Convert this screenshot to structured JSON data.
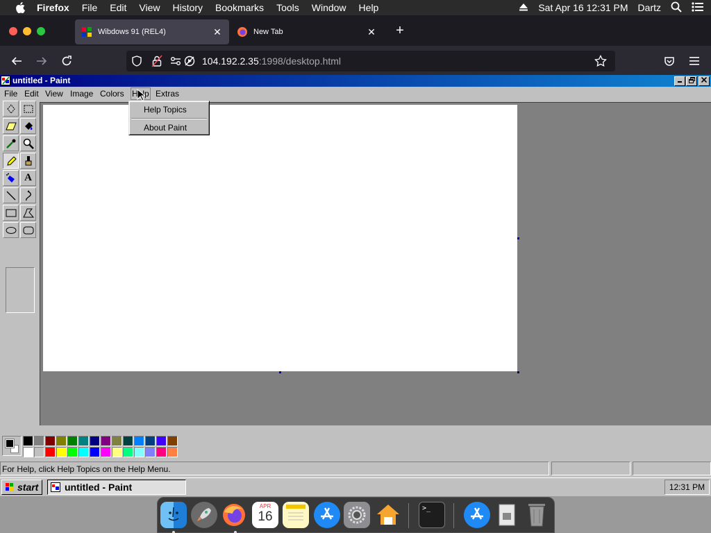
{
  "mac_menubar": {
    "app_name": "Firefox",
    "items": [
      "File",
      "Edit",
      "View",
      "History",
      "Bookmarks",
      "Tools",
      "Window",
      "Help"
    ],
    "datetime": "Sat Apr 16  12:31 PM",
    "user": "Dartz"
  },
  "browser": {
    "tabs": [
      {
        "title": "Wibdows 91 (REL4)",
        "active": true
      },
      {
        "title": "New Tab",
        "active": false
      }
    ],
    "url_host": "104.192.2.35",
    "url_path": ":1998/desktop.html"
  },
  "paint": {
    "title": "untitled - Paint",
    "menus": [
      "File",
      "Edit",
      "View",
      "Image",
      "Colors",
      "Help",
      "Extras"
    ],
    "help_menu_items": [
      "Help Topics",
      "About Paint"
    ],
    "status_text": "For Help, click Help Topics on the Help Menu.",
    "palette_top": [
      "#000000",
      "#808080",
      "#800000",
      "#808000",
      "#008000",
      "#008080",
      "#000080",
      "#800080",
      "#808040",
      "#004040",
      "#0080ff",
      "#004080",
      "#4000ff",
      "#804000"
    ],
    "palette_bottom": [
      "#ffffff",
      "#c0c0c0",
      "#ff0000",
      "#ffff00",
      "#00ff00",
      "#00ffff",
      "#0000ff",
      "#ff00ff",
      "#ffff80",
      "#00ff80",
      "#80ffff",
      "#8080ff",
      "#ff0080",
      "#ff8040"
    ],
    "foreground_color": "#000000",
    "background_color": "#ffffff"
  },
  "taskbar": {
    "start_label": "start",
    "task_label": "untitled - Paint",
    "clock": "12:31 PM"
  },
  "dock": {
    "calendar_month": "APR",
    "calendar_day": "16"
  }
}
